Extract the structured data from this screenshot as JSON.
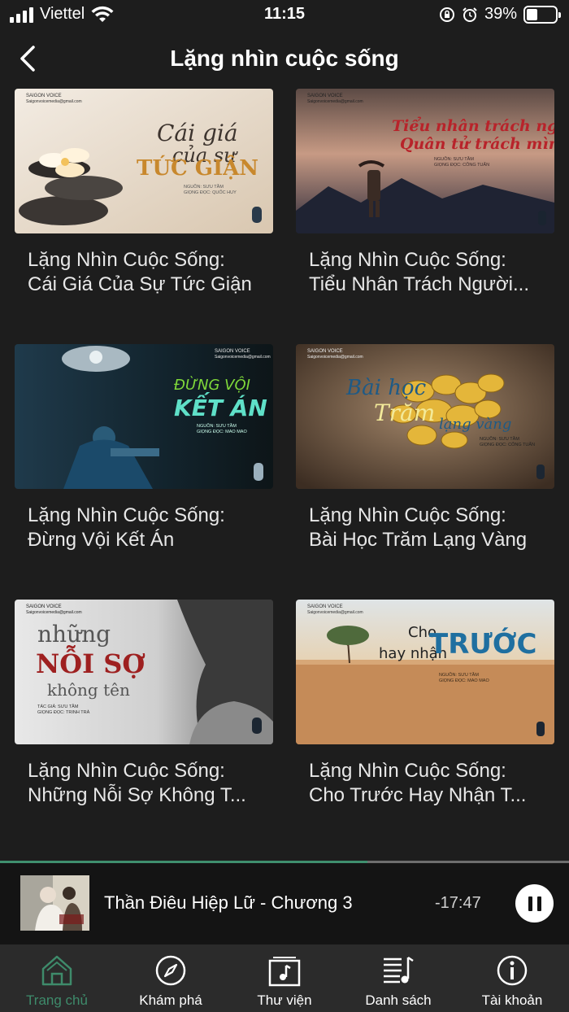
{
  "status_bar": {
    "carrier": "Viettel",
    "time": "11:15",
    "battery": "39%",
    "icons": [
      "signal-icon",
      "wifi-icon",
      "orientation-lock-icon",
      "alarm-icon",
      "battery-icon"
    ]
  },
  "header": {
    "title": "Lặng nhìn cuộc sống",
    "back_icon": "chevron-left-icon"
  },
  "cards": [
    {
      "title_line1": "Lặng Nhìn Cuộc Sống:",
      "title_line2": "Cái Giá Của Sự Tức Giận",
      "thumb": {
        "brand": "SAIGON VOICE",
        "email": "Saigonvoicemedia@gmail.com",
        "heading_a": "Cái giá",
        "heading_b": "của sự",
        "heading_c": "TỨC GIẬN",
        "credit1": "NGUỒN: SƯU TẦM",
        "credit2": "GIỌNG ĐỌC: QUỐC HUY"
      }
    },
    {
      "title_line1": "Lặng Nhìn Cuộc Sống:",
      "title_line2": "Tiểu Nhân Trách Người...",
      "thumb": {
        "brand": "SAIGON VOICE",
        "email": "Saigonvoicemedia@gmail.com",
        "heading_a": "Tiểu nhân trách người",
        "heading_b": "Quân tử trách mình",
        "credit1": "NGUỒN: SƯU TẦM",
        "credit2": "GIỌNG ĐỌC: CÔNG TUẤN"
      }
    },
    {
      "title_line1": "Lặng Nhìn Cuộc Sống:",
      "title_line2": "Đừng Vội Kết Án",
      "thumb": {
        "brand": "SAIGON VOICE",
        "email": "Saigonvoicemedia@gmail.com",
        "heading_a": "ĐỪNG VỘI",
        "heading_b": "KẾT ÁN",
        "credit1": "NGUỒN: SƯU TẦM",
        "credit2": "GIỌNG ĐỌC: MAO MAO"
      }
    },
    {
      "title_line1": "Lặng Nhìn Cuộc Sống:",
      "title_line2": "Bài Học Trăm Lạng Vàng",
      "thumb": {
        "brand": "SAIGON VOICE",
        "email": "Saigonvoicemedia@gmail.com",
        "heading_a": "Bài học",
        "heading_b": "Trăm",
        "heading_c": "lạng vàng",
        "credit1": "NGUỒN: SƯU TẦM",
        "credit2": "GIỌNG ĐỌC: CÔNG TUẤN"
      }
    },
    {
      "title_line1": "Lặng Nhìn Cuộc Sống:",
      "title_line2": "Những Nỗi Sợ Không T...",
      "thumb": {
        "brand": "SAIGON VOICE",
        "email": "Saigonvoicemedia@gmail.com",
        "heading_a": "những",
        "heading_b": "NỖI SỢ",
        "heading_c": "không tên",
        "credit1": "TÁC GIẢ: SƯU TẦM",
        "credit2": "GIỌNG ĐỌC: TRINH TRÀ"
      }
    },
    {
      "title_line1": "Lặng Nhìn Cuộc Sống:",
      "title_line2": "Cho Trước Hay Nhận T...",
      "thumb": {
        "brand": "SAIGON VOICE",
        "email": "Saigonvoicemedia@gmail.com",
        "heading_a": "Cho",
        "heading_b": "hay nhận",
        "heading_c": "TRƯỚC",
        "credit1": "NGUỒN: SƯU TẦM",
        "credit2": "GIỌNG ĐỌC: MAO MAO"
      }
    }
  ],
  "player": {
    "title": "Thần Điêu Hiệp Lữ - Chương 3",
    "remaining": "-17:47",
    "progress": 0.645,
    "state_icon": "pause-icon"
  },
  "tabs": [
    {
      "label": "Trang chủ",
      "icon": "home-icon",
      "active": true
    },
    {
      "label": "Khám phá",
      "icon": "compass-icon",
      "active": false
    },
    {
      "label": "Thư viện",
      "icon": "library-icon",
      "active": false
    },
    {
      "label": "Danh sách",
      "icon": "playlist-icon",
      "active": false
    },
    {
      "label": "Tài khoản",
      "icon": "info-icon",
      "active": false
    }
  ],
  "colors": {
    "background": "#1d1d1d",
    "accent": "#3e8b6b",
    "tab_bar": "#2b2b2b",
    "player_bg": "#141414"
  }
}
